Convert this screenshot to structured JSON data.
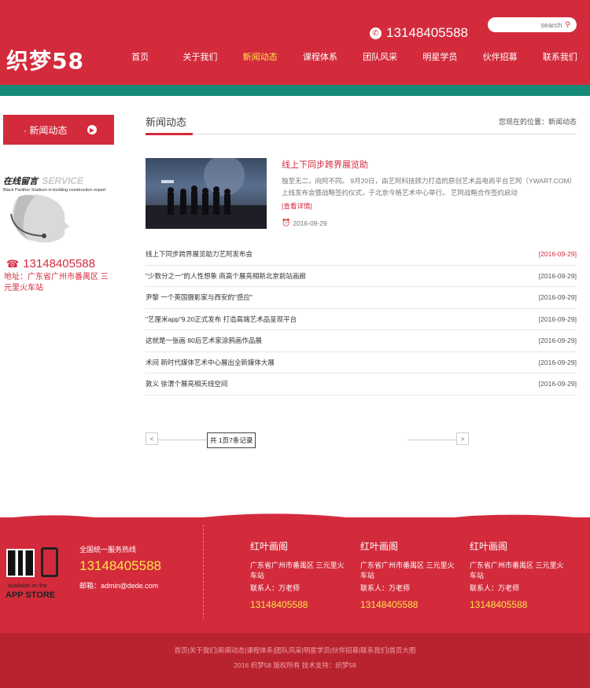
{
  "header": {
    "logo": "织梦58",
    "phone": "13148405588",
    "search_placeholder": "search",
    "nav": [
      "首页",
      "关于我们",
      "新闻动态",
      "课程体系",
      "团队风采",
      "明星学员",
      "伙伴招募",
      "联系我们"
    ],
    "active_nav": "新闻动态"
  },
  "sidebar": {
    "title": "· 新闻动态",
    "service_zh": "在线留言",
    "service_en": "SERVICE",
    "service_sub": "Black Panther Stadium in building construction expert",
    "phone": "13148405588",
    "address": "地址：广东省广州市番禺区 三元里火车站"
  },
  "main": {
    "title": "新闻动态",
    "breadcrumb": "您现在的位置：新闻动态",
    "feature": {
      "title": "线上下同步跨界展览助",
      "desc": "独至无二，向阿不同。 9月20日，由艺阿科技顾力打造的原创艺术品电商平台艺阿（YWART.COM）上线发布会暨战略签约仪式，于北京今格艺术中心举行。 艺阿战略合作签约启动",
      "more": "[查看详情]",
      "date": "2016-09-29"
    },
    "news": [
      {
        "title": "线上下同步跨界展览助力艺阿发布会",
        "date": "[2016-09-29]"
      },
      {
        "title": "\"少数分之一\"的人性想象 商高个展亮相新北京前站画廊",
        "date": "[2016-09-29]"
      },
      {
        "title": "尹黎 一个英国摄影家与西安的\"感应\"",
        "date": "[2016-09-29]"
      },
      {
        "title": "\"艺厘米app\"9.20正式发布 打造高端艺术品呈现平台",
        "date": "[2016-09-29]"
      },
      {
        "title": "这就是一张画 80后艺术家涂鸦画作品展",
        "date": "[2016-09-29]"
      },
      {
        "title": "术间 新时代媒体艺术中心展出全新媒体大展",
        "date": "[2016-09-29]"
      },
      {
        "title": "敦义 徐渭个展亮相天线空间",
        "date": "[2016-09-29]"
      }
    ],
    "pager": {
      "prev": "<",
      "next": ">",
      "count": "共 1页7条记录"
    }
  },
  "footer": {
    "app_available": "Available on the",
    "app_store": "APP STORE",
    "hotline_label": "全国统一服务热线",
    "hotline": "13148405588",
    "email": "邮箱：admin@dede.com",
    "branches": [
      {
        "name": "红叶画阁",
        "addr": "广东省广州市番禺区 三元里火车站",
        "person": "联系人：万老师",
        "phone": "13148405588"
      },
      {
        "name": "红叶画阁",
        "addr": "广东省广州市番禺区 三元里火车站",
        "person": "联系人：万老师",
        "phone": "13148405588"
      },
      {
        "name": "红叶画阁",
        "addr": "广东省广州市番禺区 三元里火车站",
        "person": "联系人：万老师",
        "phone": "13148405588"
      }
    ],
    "links": [
      "首页",
      "关于我们",
      "新闻动态",
      "课程体系",
      "团队风采",
      "明星学员",
      "伙伴招募",
      "联系我们",
      "首页大图"
    ],
    "copyright": "2016 织梦58 版权所有 技术支持：织梦58"
  },
  "colors": {
    "brand_red": "#d32b3c",
    "teal_band": "#168a78",
    "highlight_yellow": "#ffe24d"
  }
}
